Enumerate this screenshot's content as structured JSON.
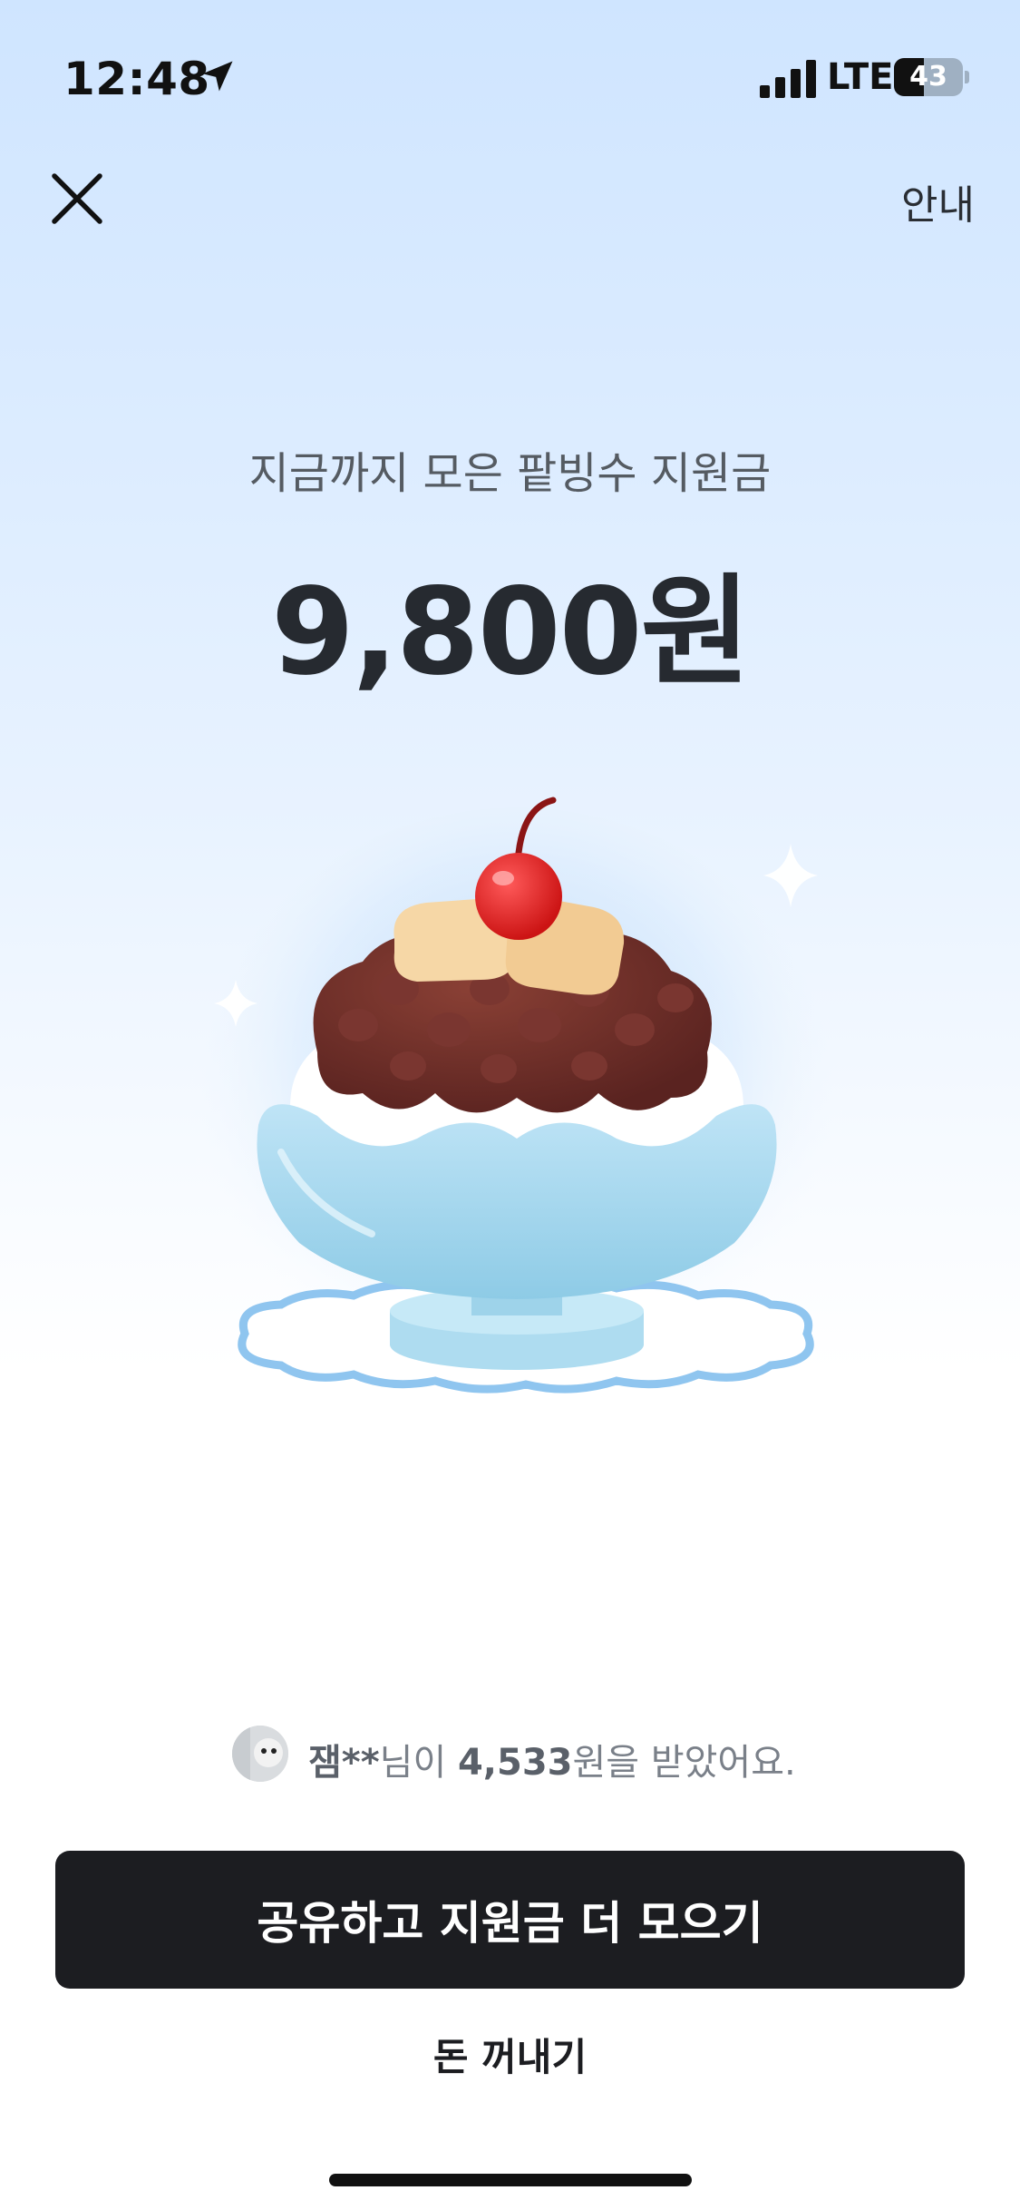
{
  "status_bar": {
    "time": "12:48",
    "network": "LTE",
    "battery_percent": "43",
    "battery_level": 0.43,
    "icons": [
      "location-arrow-icon",
      "signal-bars-icon",
      "battery-icon"
    ]
  },
  "header": {
    "close_icon": "close-icon",
    "info_label": "안내"
  },
  "summary": {
    "headline": "지금까지 모은 팥빙수 지원금",
    "amount": "9,800원"
  },
  "illustration": {
    "name": "red-bean-shaved-ice-icon"
  },
  "ticker": {
    "user": "잼**",
    "text_1": "님이 ",
    "amount": "4,533",
    "text_2": "원을 받았어요."
  },
  "actions": {
    "primary_label": "공유하고 지원금 더 모으기",
    "secondary_label": "돈 꺼내기"
  },
  "colors": {
    "primary_button": "#1c1d21",
    "amount_text": "#262a30",
    "background_top": "#cfe5ff"
  }
}
